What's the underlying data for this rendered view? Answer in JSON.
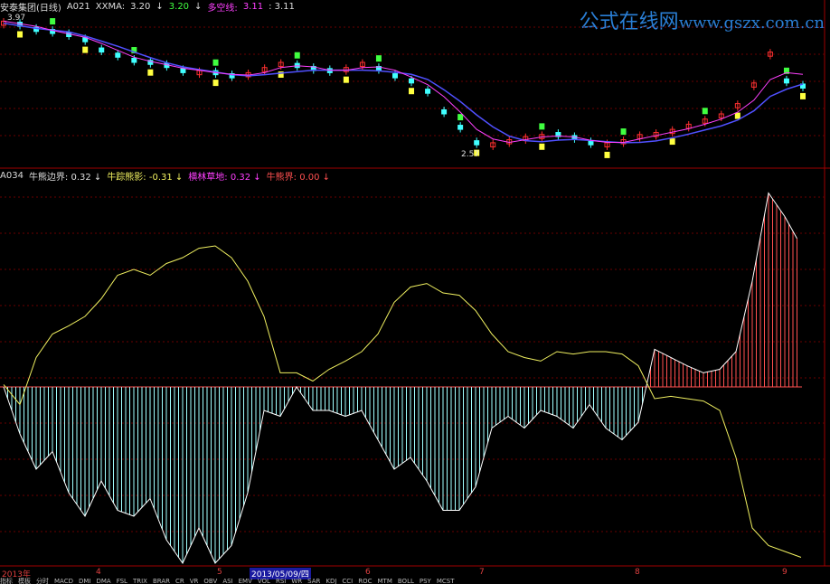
{
  "top_panel": {
    "stock_name": "安泰集团(日线)",
    "indicator": "A021",
    "xxma_label": "XXMA:",
    "xxma_value": "3.20",
    "val2": "3.20",
    "duokong_label": "多空线:",
    "duokong_value": "3.11",
    "val4": ": 3.11",
    "high_label": "3.97",
    "low_label": "2.57"
  },
  "bottom_panel": {
    "indicator": "A034",
    "items": [
      {
        "label": "牛熊边界:",
        "value": "0.32",
        "color": "#dddddd"
      },
      {
        "label": "牛踪熊影:",
        "value": "-0.31",
        "color": "#f0f060"
      },
      {
        "label": "横林草地:",
        "value": "0.32",
        "color": "#ff40ff"
      },
      {
        "label": "牛熊界:",
        "value": "0.00",
        "color": "#ff5050"
      }
    ]
  },
  "watermark": {
    "cn": "公式在线网",
    "url": "www.gszx.com.cn"
  },
  "x_axis": {
    "year": "2013年",
    "months": [
      "4",
      "5",
      "6",
      "7",
      "8",
      "9"
    ],
    "selected_date": "2013/05/09/四"
  },
  "tabs": [
    "指标",
    "模板",
    "分时",
    "MACD",
    "DMI",
    "DMA",
    "FSL",
    "TRIX",
    "BRAR",
    "CR",
    "VR",
    "OBV",
    "ASI",
    "EMV",
    "VOL",
    "RSI",
    "WR",
    "SAR",
    "KDJ",
    "CCI",
    "ROC",
    "MTM",
    "BOLL",
    "PSY",
    "MCST"
  ],
  "colors": {
    "up": "#ff3030",
    "down": "#40ffff",
    "ma": "#5050ff",
    "line2": "#ff40ff",
    "osc": "#f0f060",
    "hist_neg": "#a0ffff",
    "hist_pos": "#ff5050",
    "grid": "#6a0000"
  },
  "chart_data": {
    "type": "line",
    "price_path": [
      3.9,
      3.85,
      3.8,
      3.78,
      3.75,
      3.7,
      3.6,
      3.55,
      3.5,
      3.48,
      3.45,
      3.4,
      3.42,
      3.38,
      3.35,
      3.4,
      3.45,
      3.5,
      3.45,
      3.42,
      3.4,
      3.45,
      3.5,
      3.42,
      3.35,
      3.3,
      3.2,
      3.0,
      2.85,
      2.7,
      2.72,
      2.75,
      2.78,
      2.8,
      2.78,
      2.75,
      2.7,
      2.72,
      2.75,
      2.8,
      2.82,
      2.85,
      2.9,
      2.95,
      3.0,
      3.1,
      3.3,
      3.6,
      3.3,
      3.25
    ],
    "oscillator": [
      0.02,
      -0.15,
      0.25,
      0.45,
      0.52,
      0.6,
      0.75,
      0.95,
      1.0,
      0.95,
      1.05,
      1.1,
      1.18,
      1.2,
      1.1,
      0.9,
      0.6,
      0.12,
      0.12,
      0.05,
      0.15,
      0.22,
      0.3,
      0.45,
      0.72,
      0.85,
      0.88,
      0.8,
      0.78,
      0.65,
      0.45,
      0.3,
      0.25,
      0.22,
      0.3,
      0.28,
      0.3,
      0.3,
      0.28,
      0.18,
      -0.1,
      -0.08,
      -0.1,
      -0.12,
      -0.2,
      -0.6,
      -1.2,
      -1.35,
      -1.4,
      -1.45
    ],
    "histogram": [
      0.0,
      -0.4,
      -0.7,
      -0.55,
      -0.9,
      -1.1,
      -0.8,
      -1.05,
      -1.1,
      -0.95,
      -1.3,
      -1.5,
      -1.2,
      -1.5,
      -1.35,
      -0.9,
      -0.2,
      -0.25,
      0.0,
      -0.2,
      -0.2,
      -0.25,
      -0.2,
      -0.45,
      -0.7,
      -0.6,
      -0.8,
      -1.05,
      -1.05,
      -0.85,
      -0.35,
      -0.25,
      -0.35,
      -0.2,
      -0.25,
      -0.35,
      -0.15,
      -0.35,
      -0.45,
      -0.3,
      0.32,
      0.25,
      0.18,
      0.12,
      0.15,
      0.3,
      0.9,
      1.65,
      1.45,
      1.2
    ]
  }
}
